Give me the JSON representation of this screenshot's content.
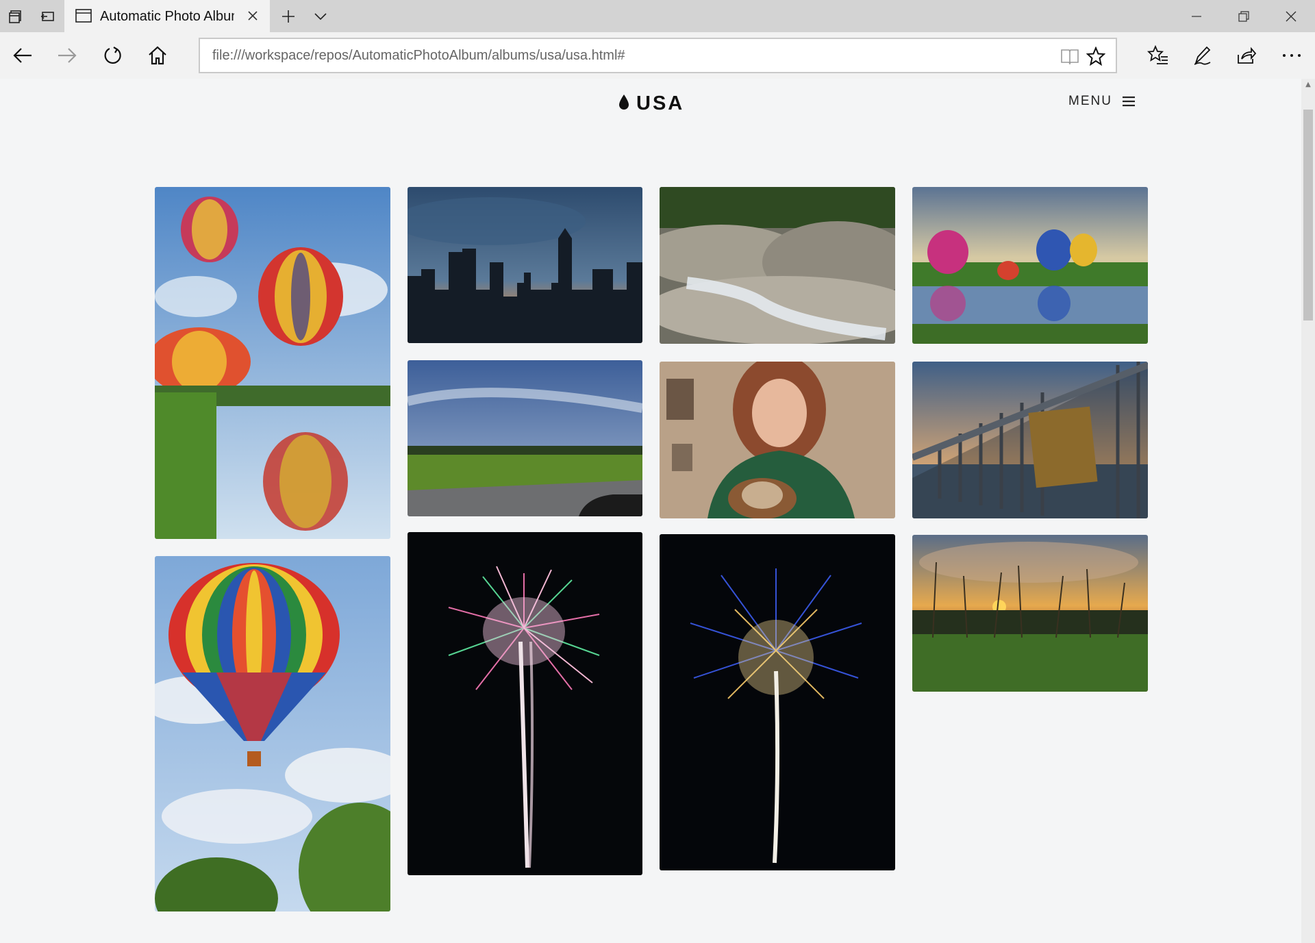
{
  "browser": {
    "tab_title": "Automatic Photo Album",
    "address_url": "file:///workspace/repos/AutomaticPhotoAlbum/albums/usa/usa.html#"
  },
  "page": {
    "title": "USA",
    "menu_label": "MENU"
  },
  "photos": [
    {
      "subject": "hot air balloons reflected in pond"
    },
    {
      "subject": "city skyline at dusk"
    },
    {
      "subject": "stream over rocks"
    },
    {
      "subject": "balloons over lake"
    },
    {
      "subject": "green field under sky"
    },
    {
      "subject": "woman in deer sweater"
    },
    {
      "subject": "bridge railing with plaque"
    },
    {
      "subject": "striped hot air balloon"
    },
    {
      "subject": "pink and green fireworks"
    },
    {
      "subject": "blue and gold fireworks"
    },
    {
      "subject": "sunset over tall grass"
    }
  ],
  "colors": {
    "accent": "#111111",
    "background": "#f4f5f6"
  }
}
